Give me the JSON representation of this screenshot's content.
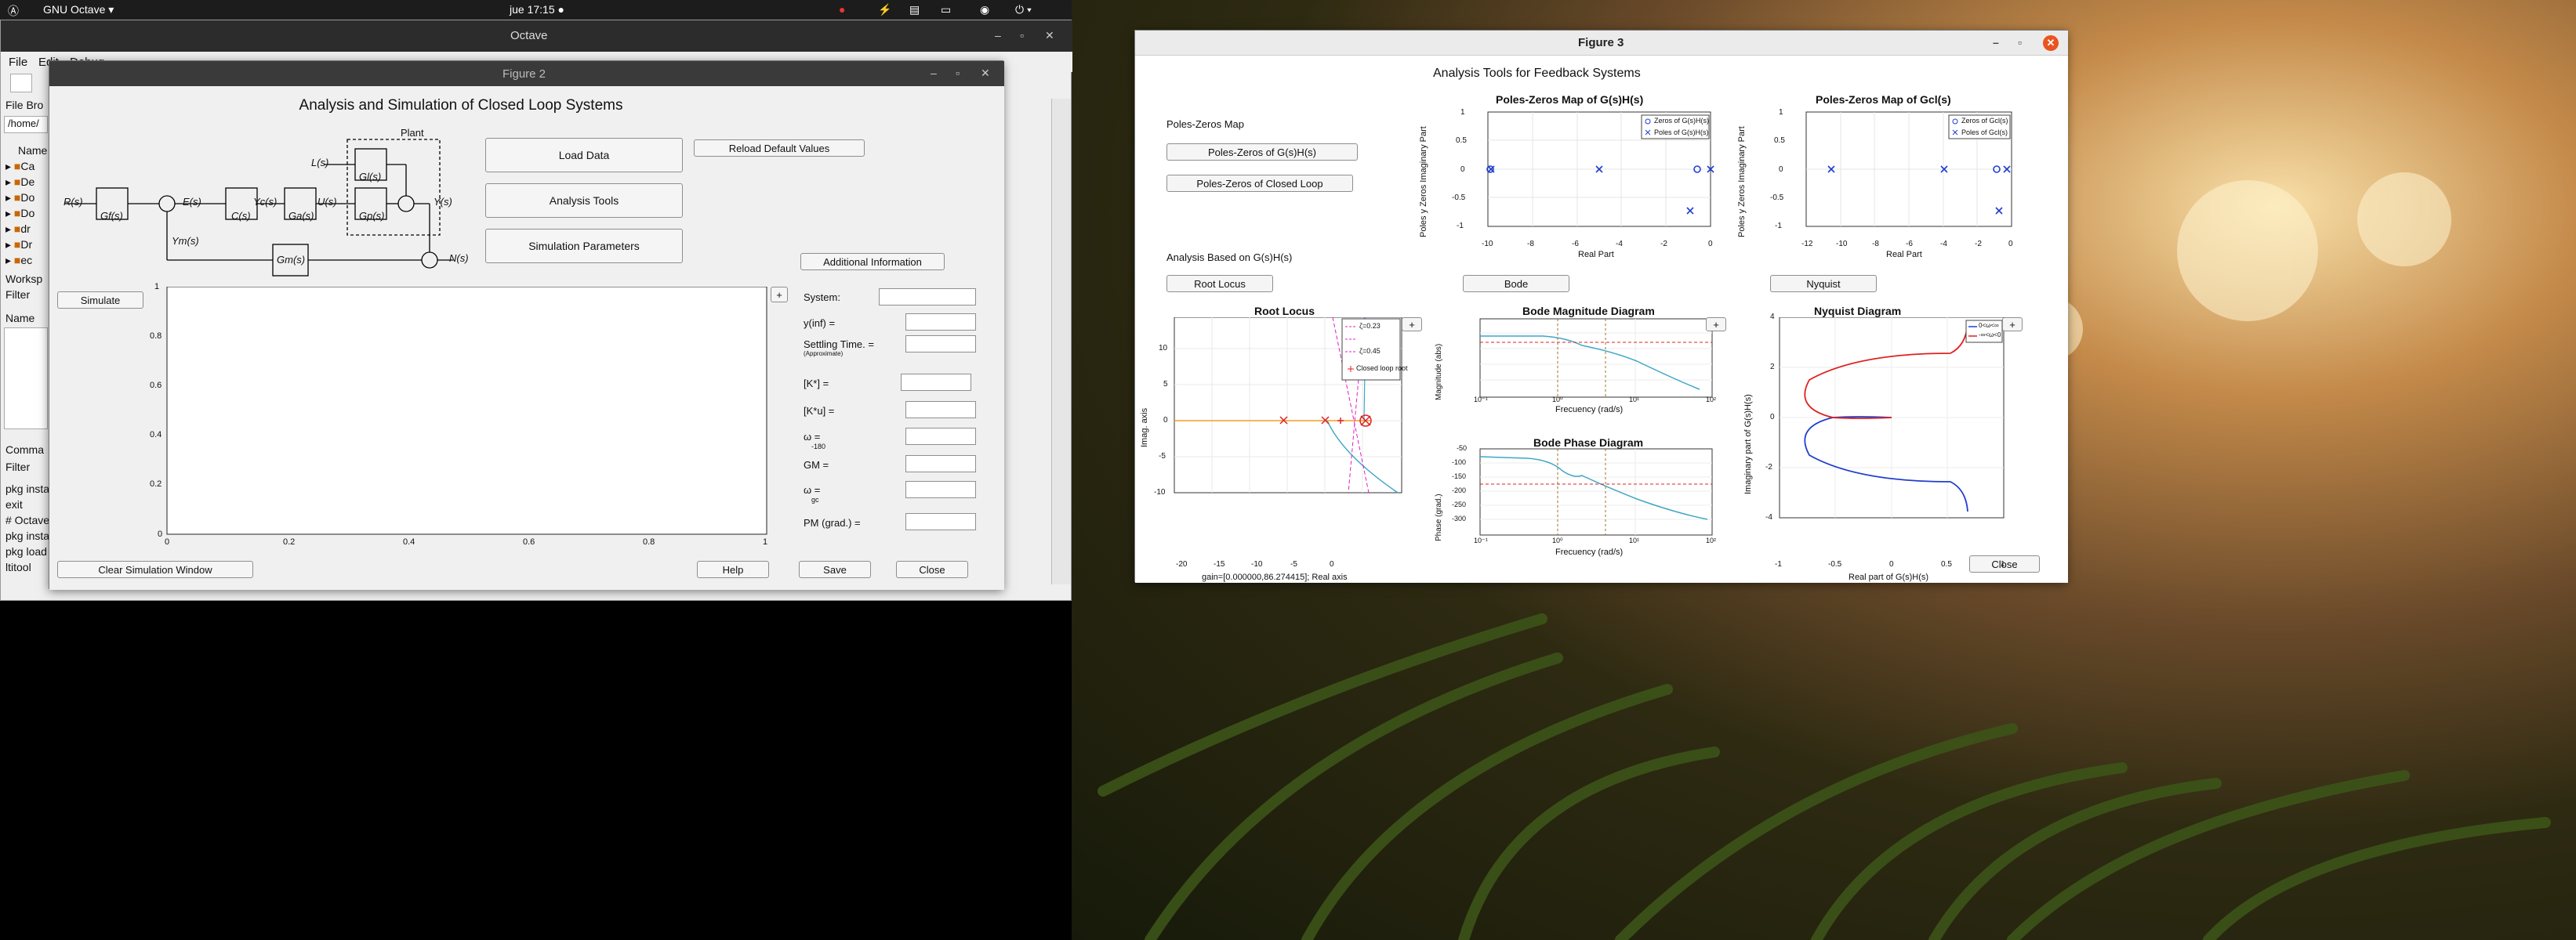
{
  "topbar": {
    "activities": "Ⓐ",
    "app_menu": "GNU Octave ▾",
    "clock": "jue 17:15 ●",
    "tray": [
      "●",
      "⚡",
      "▤",
      "▭",
      "◉",
      "⏻ ▾"
    ]
  },
  "octave": {
    "title": "Octave",
    "menus": [
      "File",
      "Edit",
      "Debug"
    ],
    "side": {
      "file_browser": "File Bro",
      "path": "/home/",
      "name_header": "Name",
      "tree": [
        "Ca",
        "De",
        "Do",
        "Do",
        "dr",
        "Dr",
        "ec"
      ],
      "workspace": "Worksp",
      "filter": "Filter",
      "ws_name": "Name",
      "command": "Comma",
      "cmd_filter": "Filter",
      "cmd_lines": [
        "pkg insta",
        "exit",
        "# Octave",
        "pkg insta",
        "pkg load",
        "ltitool"
      ]
    }
  },
  "fig2": {
    "title": "Figure 2",
    "heading": "Analysis and Simulation of Closed Loop Systems",
    "buttons": {
      "load": "Load Data",
      "analysis": "Analysis Tools",
      "sim": "Simulation Parameters",
      "reload": "Reload Default Values",
      "info": "Additional Information",
      "simulate": "Simulate",
      "clear": "Clear Simulation Window",
      "help": "Help",
      "save": "Save",
      "close": "Close",
      "plus": "+"
    },
    "diagram": {
      "plant": "Plant",
      "R": "R(s)",
      "Gf": "Gf(s)",
      "E": "E(s)",
      "C": "C(s)",
      "Yc": "Yc(s)",
      "Ga": "Ga(s)",
      "U": "U(s)",
      "L": "L(s)",
      "Gl": "Gl(s)",
      "Gp": "Gp(s)",
      "Y": "Y(s)",
      "N": "N(s)",
      "Ym": "Ym(s)",
      "Gm": "Gm(s)"
    },
    "fields": [
      "System:",
      "y(inf) =",
      "Settling Time. =",
      "(Approximate)",
      "[K*] =",
      "[K*u] =",
      "ω  =",
      "-180",
      "GM =",
      "ω  =",
      "gc",
      "PM (grad.) ="
    ],
    "axes": {
      "y_ticks": [
        "1",
        "0.8",
        "0.6",
        "0.4",
        "0.2",
        "0"
      ],
      "x_ticks": [
        "0",
        "0.2",
        "0.4",
        "0.6",
        "0.8",
        "1"
      ]
    }
  },
  "fig3": {
    "title": "Figure 3",
    "heading": "Analysis Tools for Feedback Systems",
    "labels": {
      "pz_map": "Poles-Zeros Map",
      "analysis_based": "Analysis Based on G(s)H(s)"
    },
    "buttons": {
      "pz_open": "Poles-Zeros of G(s)H(s)",
      "pz_closed": "Poles-Zeros of Closed Loop",
      "root_locus": "Root Locus",
      "bode": "Bode",
      "nyquist": "Nyquist",
      "close": "Close",
      "plus": "+"
    },
    "pz1": {
      "title": "Poles-Zeros Map of G(s)H(s)",
      "xlabel": "Real Part",
      "ylabel": "Poles y Zeros Imaginary Part",
      "legend": [
        "Zeros of G(s)H(s)",
        "Poles of G(s)H(s)"
      ],
      "xticks": [
        "-10",
        "-8",
        "-6",
        "-4",
        "-2",
        "0"
      ],
      "yticks": [
        "1",
        "0.5",
        "0",
        "-0.5",
        "-1"
      ]
    },
    "pz2": {
      "title": "Poles-Zeros Map of Gcl(s)",
      "xlabel": "Real Part",
      "ylabel": "Poles y Zeros Imaginary Part",
      "legend": [
        "Zeros of Gcl(s)",
        "Poles of Gcl(s)"
      ],
      "xticks": [
        "-12",
        "-10",
        "-8",
        "-6",
        "-4",
        "-2",
        "0"
      ],
      "yticks": [
        "1",
        "0.5",
        "0",
        "-0.5",
        "-1"
      ]
    },
    "rl": {
      "title": "Root Locus",
      "ylabel": "Imag. axis",
      "xlabel": "gain=[0.000000,86.274415]; Real axis",
      "legend": [
        "ζ=0.23",
        "",
        "ζ=0.45",
        "Closed loop root"
      ],
      "xticks": [
        "-20",
        "-15",
        "-10",
        "-5",
        "0"
      ],
      "yticks": [
        "10",
        "5",
        "0",
        "-5",
        "-10"
      ]
    },
    "bodem": {
      "title": "Bode Magnitude Diagram",
      "ylabel": "Magnitude (abs)",
      "xlabel": "Frecuency (rad/s)"
    },
    "bodep": {
      "title": "Bode Phase Diagram",
      "ylabel": "Phase (grad.)",
      "xlabel": "Frecuency (rad/s)",
      "yticks": [
        "-50",
        "-100",
        "-150",
        "-200",
        "-250",
        "-300"
      ]
    },
    "nyq": {
      "title": "Nyquist Diagram",
      "ylabel": "Imaginary part of G(s)H(s)",
      "xlabel": "Real part of G(s)H(s)",
      "legend": [
        "0<ω<∞",
        "-∞<ω<0"
      ],
      "xticks": [
        "-1",
        "-0.5",
        "0",
        "0.5",
        "1"
      ],
      "yticks": [
        "4",
        "2",
        "0",
        "-2",
        "-4"
      ]
    },
    "log_ticks": [
      "10⁻¹",
      "10⁰",
      "10¹",
      "10²"
    ]
  },
  "colors": {
    "accent_close": "#e95420",
    "series_blue": "#1f3fcf",
    "series_red": "#e02020",
    "bode_line": "#3fa7c7"
  }
}
